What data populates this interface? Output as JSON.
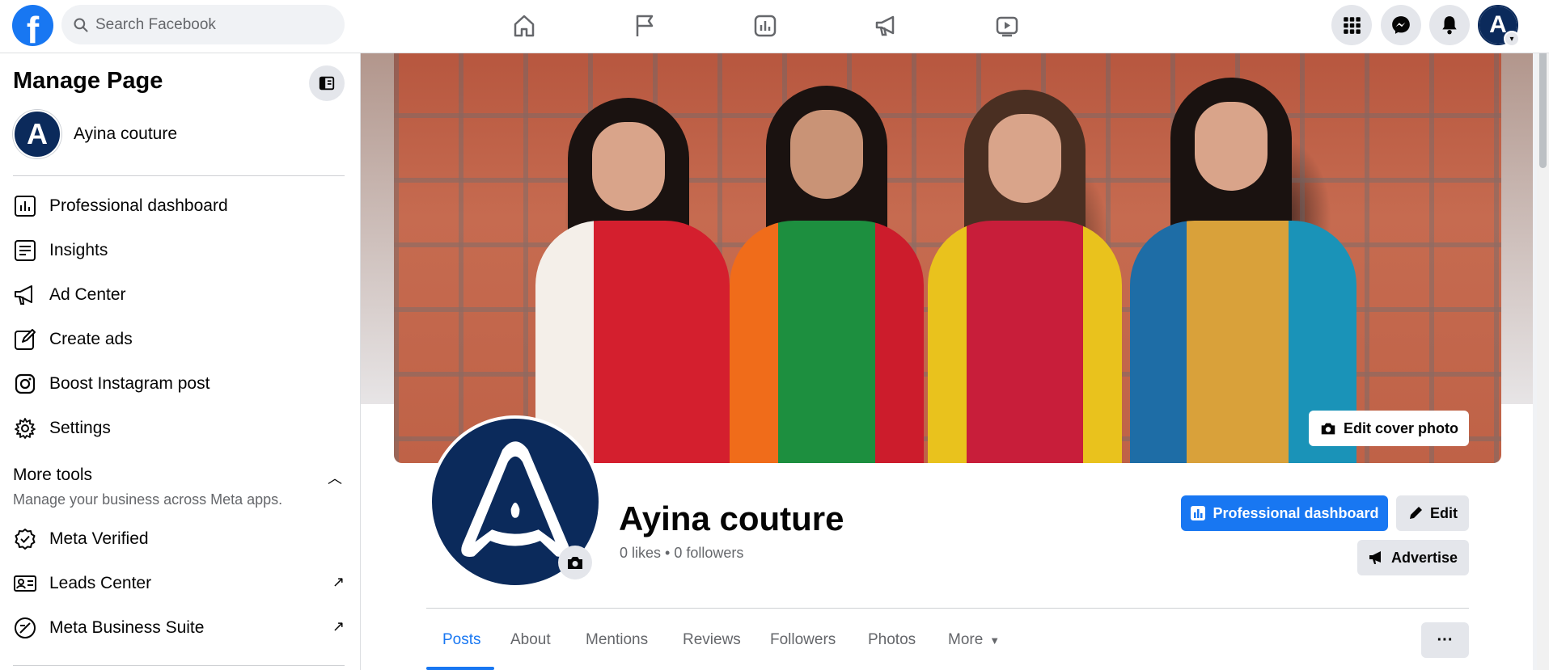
{
  "header": {
    "logo_letter": "f",
    "search_placeholder": "Search Facebook",
    "nav_icons": [
      "home-icon",
      "flag-icon",
      "chart-icon",
      "megaphone-icon",
      "video-icon"
    ],
    "right_icons": [
      "menu-grid-icon",
      "messenger-icon",
      "bell-icon"
    ]
  },
  "sidebar": {
    "title": "Manage Page",
    "page_name": "Ayina couture",
    "items": [
      {
        "label": "Professional dashboard",
        "icon": "chart-icon"
      },
      {
        "label": "Insights",
        "icon": "insights-icon"
      },
      {
        "label": "Ad Center",
        "icon": "megaphone-icon"
      },
      {
        "label": "Create ads",
        "icon": "pencil-icon"
      },
      {
        "label": "Boost Instagram post",
        "icon": "instagram-icon"
      },
      {
        "label": "Settings",
        "icon": "gear-icon"
      }
    ],
    "more_tools_title": "More tools",
    "more_tools_subtitle": "Manage your business across Meta apps.",
    "tools": [
      {
        "label": "Meta Verified",
        "icon": "verified-icon"
      },
      {
        "label": "Leads Center",
        "icon": "id-card-icon"
      },
      {
        "label": "Meta Business Suite",
        "icon": "business-suite-icon"
      }
    ]
  },
  "profile": {
    "page_name": "Ayina couture",
    "stats": "0 likes • 0 followers",
    "edit_cover_label": "Edit cover photo",
    "dashboard_label": "Professional dashboard",
    "edit_label": "Edit",
    "advertise_label": "Advertise",
    "avatar_letter": "A"
  },
  "tabs": [
    "Posts",
    "About",
    "Mentions",
    "Reviews",
    "Followers",
    "Photos",
    "More"
  ],
  "colors": {
    "accent": "#1877f2",
    "avatar_bg": "#0b2a5b"
  }
}
